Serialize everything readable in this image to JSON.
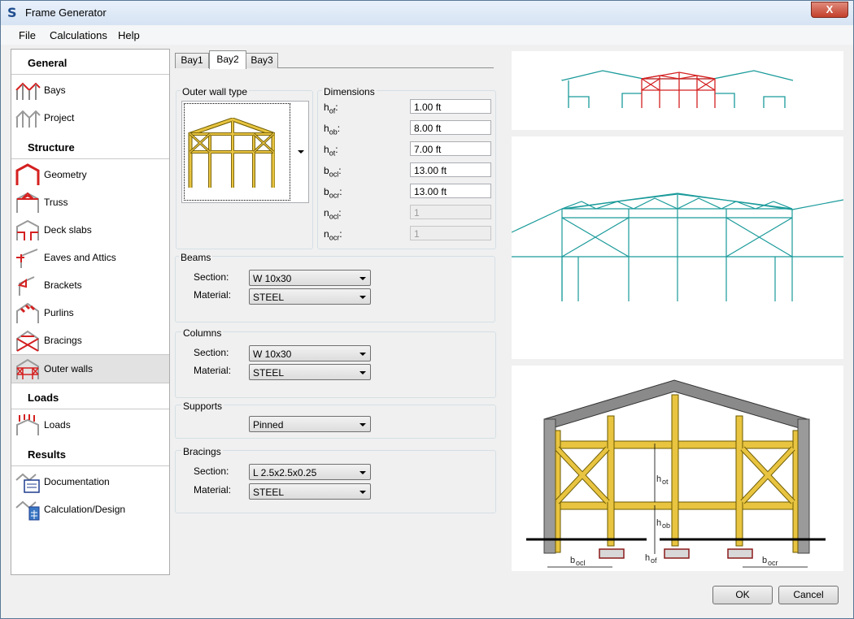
{
  "window": {
    "title": "Frame Generator",
    "app_icon_letter": "S",
    "close_glyph": "X"
  },
  "menu": [
    "File",
    "Calculations",
    "Help"
  ],
  "nav": {
    "sections": [
      {
        "header": "General",
        "items": [
          "Bays",
          "Project"
        ]
      },
      {
        "header": "Structure",
        "items": [
          "Geometry",
          "Truss",
          "Deck slabs",
          "Eaves and Attics",
          "Brackets",
          "Purlins",
          "Bracings",
          "Outer walls"
        ]
      },
      {
        "header": "Loads",
        "items": [
          "Loads"
        ]
      },
      {
        "header": "Results",
        "items": [
          "Documentation",
          "Calculation/Design"
        ]
      }
    ],
    "selected": "Outer walls"
  },
  "tabs": {
    "items": [
      "Bay1",
      "Bay2",
      "Bay3"
    ],
    "active": "Bay2"
  },
  "outer_wall_type": {
    "title": "Outer wall type"
  },
  "dimensions": {
    "title": "Dimensions",
    "fields": [
      {
        "sym": "h",
        "sub": "of",
        "value": "1.00 ft",
        "enabled": true
      },
      {
        "sym": "h",
        "sub": "ob",
        "value": "8.00 ft",
        "enabled": true
      },
      {
        "sym": "h",
        "sub": "ot",
        "value": "7.00 ft",
        "enabled": true
      },
      {
        "sym": "b",
        "sub": "ocl",
        "value": "13.00 ft",
        "enabled": true
      },
      {
        "sym": "b",
        "sub": "ocr",
        "value": "13.00 ft",
        "enabled": true
      },
      {
        "sym": "n",
        "sub": "ocl",
        "value": "1",
        "enabled": false
      },
      {
        "sym": "n",
        "sub": "ocr",
        "value": "1",
        "enabled": false
      }
    ]
  },
  "beams": {
    "title": "Beams",
    "section_label": "Section:",
    "section": "W 10x30",
    "material_label": "Material:",
    "material": "STEEL"
  },
  "columns": {
    "title": "Columns",
    "section_label": "Section:",
    "section": "W 10x30",
    "material_label": "Material:",
    "material": "STEEL"
  },
  "supports": {
    "title": "Supports",
    "value": "Pinned"
  },
  "bracings": {
    "title": "Bracings",
    "section_label": "Section:",
    "section": "L 2.5x2.5x0.25",
    "material_label": "Material:",
    "material": "STEEL"
  },
  "drawing_labels": {
    "hot": "ot",
    "hob": "ob",
    "hof": "of",
    "bocl": "ocl",
    "bocr": "ocr"
  },
  "buttons": {
    "ok": "OK",
    "cancel": "Cancel"
  },
  "colors": {
    "teal": "#1a9a9a",
    "red": "#d42020",
    "yellow": "#e8c440",
    "grey": "#8a8a8a"
  }
}
